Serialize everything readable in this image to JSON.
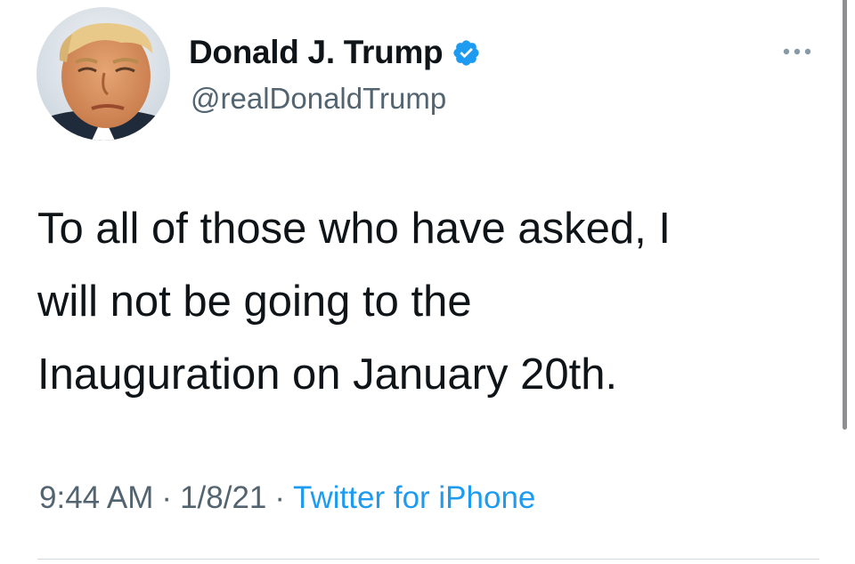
{
  "author": {
    "display_name": "Donald J. Trump",
    "handle": "@realDonaldTrump",
    "verified": true,
    "avatar_icon": "profile-photo",
    "verified_icon": "verified-badge-icon"
  },
  "more_menu_icon": "more-dots-icon",
  "tweet": {
    "text_lines": [
      "To all of those who have asked, I",
      "will not be going to the",
      "Inauguration on January 20th."
    ]
  },
  "meta": {
    "time": "9:44 AM",
    "separator": "·",
    "date": "1/8/21",
    "source": "Twitter for iPhone"
  },
  "colors": {
    "text": "#0f1419",
    "secondary": "#536471",
    "accent": "#1d9bf0",
    "divider": "#cfd9de"
  }
}
